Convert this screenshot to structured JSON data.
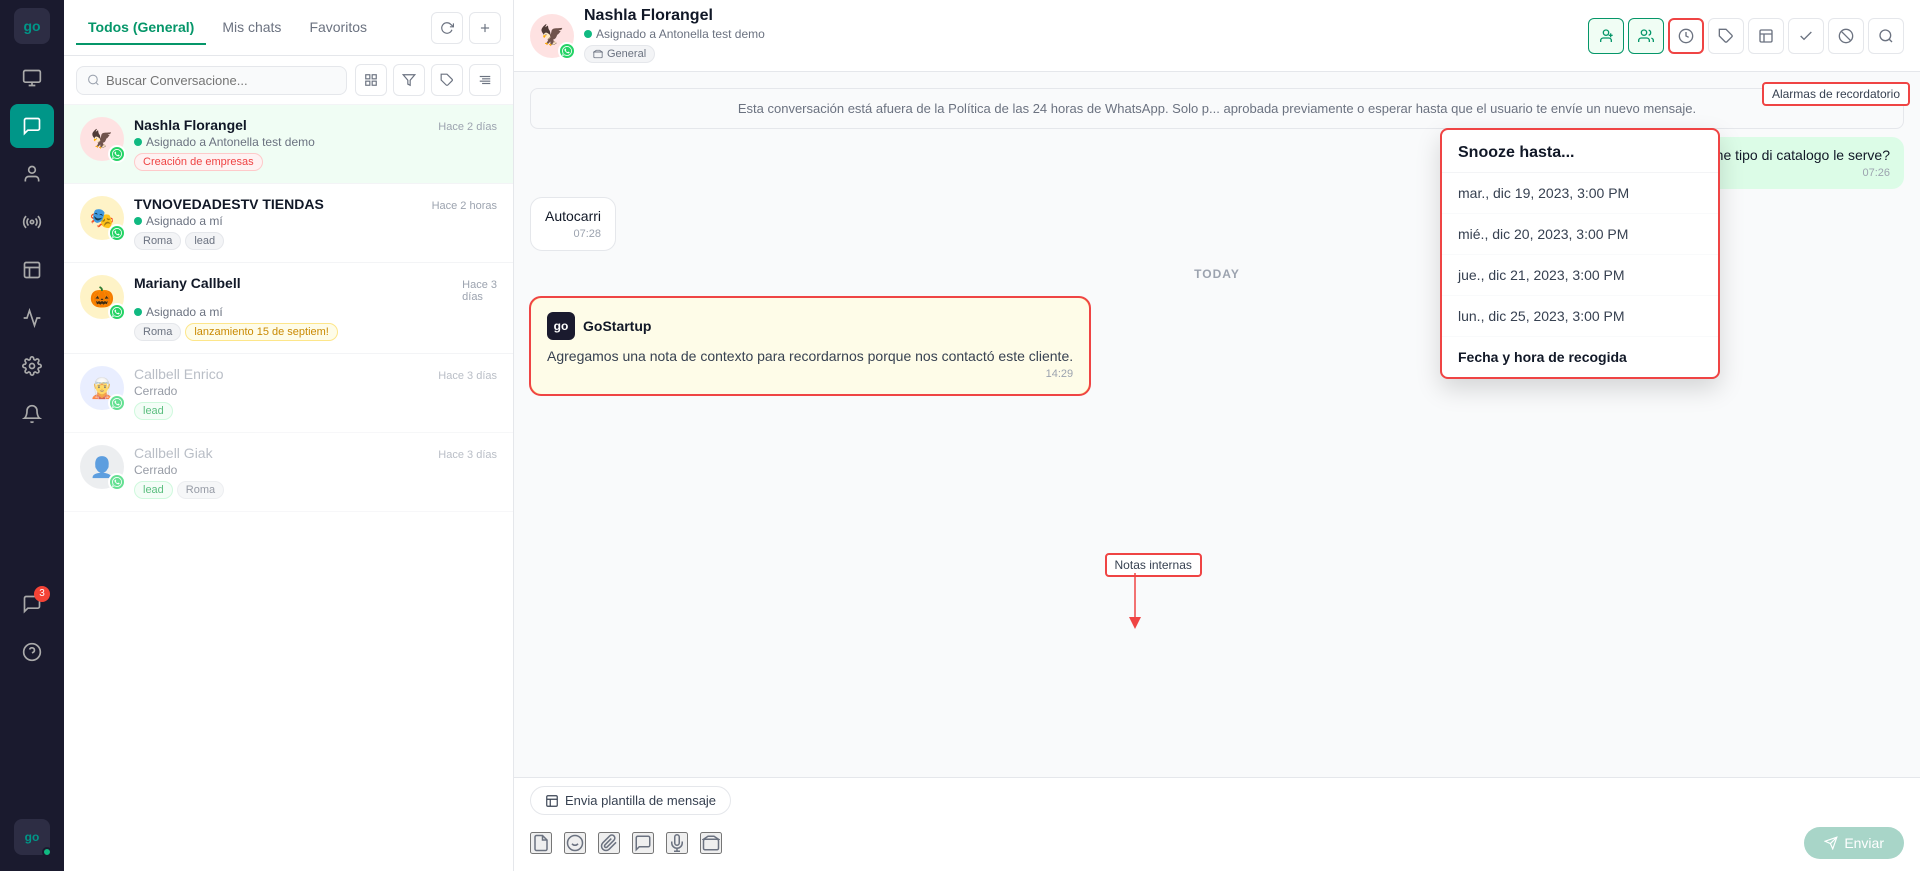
{
  "sidebar": {
    "logo": "go",
    "icons": [
      {
        "name": "home-icon",
        "symbol": "⌂",
        "active": false
      },
      {
        "name": "chat-icon",
        "symbol": "💬",
        "active": true
      },
      {
        "name": "contacts-icon",
        "symbol": "👤",
        "active": false
      },
      {
        "name": "broadcast-icon",
        "symbol": "📡",
        "active": false
      },
      {
        "name": "notes-icon",
        "symbol": "📋",
        "active": false
      },
      {
        "name": "analytics-icon",
        "symbol": "📈",
        "active": false
      },
      {
        "name": "settings-icon",
        "symbol": "⚙",
        "active": false
      },
      {
        "name": "notifications-icon",
        "symbol": "🔔",
        "active": false,
        "badge": null
      },
      {
        "name": "whatsapp-icon",
        "symbol": "💬",
        "active": false,
        "badge": "3"
      },
      {
        "name": "help-icon",
        "symbol": "?",
        "active": false
      }
    ]
  },
  "chatList": {
    "tabs": [
      {
        "label": "Todos (General)",
        "active": true
      },
      {
        "label": "Mis chats",
        "active": false
      },
      {
        "label": "Favoritos",
        "active": false
      }
    ],
    "searchPlaceholder": "Buscar Conversacione...",
    "chats": [
      {
        "id": 1,
        "name": "Nashla Florangel",
        "agent": "Asignado a Antonella test demo",
        "time": "Hace 2 días",
        "tags": [
          "Creación de empresas"
        ],
        "tagColors": [
          "red"
        ],
        "avatar": "🦅",
        "avatarBg": "#fee2e2",
        "active": true,
        "status": "online",
        "channel": "whatsapp"
      },
      {
        "id": 2,
        "name": "TVNOVEDADESTV TIENDAS",
        "agent": "Asignado a mí",
        "time": "Hace 2 horas",
        "tags": [
          "Roma",
          "lead"
        ],
        "tagColors": [
          "gray",
          "gray"
        ],
        "avatar": "🎭",
        "avatarBg": "#fef3c7",
        "active": false,
        "status": "online",
        "channel": "whatsapp"
      },
      {
        "id": 3,
        "name": "Mariany Callbell",
        "agent": "Asignado a mí",
        "time": "Hace 3 días",
        "tags": [
          "Roma",
          "lanzamiento 15 de septiem!"
        ],
        "tagColors": [
          "gray",
          "yellow"
        ],
        "avatar": "🎃",
        "avatarBg": "#fef3c7",
        "active": false,
        "status": "online",
        "channel": "whatsapp"
      },
      {
        "id": 4,
        "name": "Callbell Enrico",
        "agent": "Cerrado",
        "time": "Hace 3 días",
        "tags": [
          "lead"
        ],
        "tagColors": [
          "green"
        ],
        "avatar": "🧝",
        "avatarBg": "#e0e7ff",
        "active": false,
        "status": "offline",
        "channel": "whatsapp"
      },
      {
        "id": 5,
        "name": "Callbell Giak",
        "agent": "Cerrado",
        "time": "Hace 3 días",
        "tags": [
          "lead",
          "Roma"
        ],
        "tagColors": [
          "green",
          "gray"
        ],
        "avatar": "👤",
        "avatarBg": "#e5e7eb",
        "active": false,
        "status": "offline",
        "channel": "whatsapp"
      }
    ]
  },
  "chatHeader": {
    "contactName": "Nashla Florangel",
    "agentLabel": "Asignado a Antonella test demo",
    "inboxLabel": "General",
    "actions": [
      {
        "name": "assign-icon",
        "symbol": "👤+",
        "tooltip": "Asignar"
      },
      {
        "name": "team-icon",
        "symbol": "👥",
        "tooltip": "Equipo"
      },
      {
        "name": "snooze-icon",
        "symbol": "⏰",
        "tooltip": "Snooze",
        "highlighted": true
      },
      {
        "name": "label-icon",
        "symbol": "🏷",
        "tooltip": "Etiqueta"
      },
      {
        "name": "history-icon",
        "symbol": "📋",
        "tooltip": "Historial"
      },
      {
        "name": "resolve-icon",
        "symbol": "✓",
        "tooltip": "Resolver"
      },
      {
        "name": "block-icon",
        "symbol": "⊘",
        "tooltip": "Bloquear"
      },
      {
        "name": "search-icon",
        "symbol": "🔍",
        "tooltip": "Buscar"
      }
    ]
  },
  "messages": {
    "policyWarning": "Esta conversación está afuera de la Política de las 24 horas de WhatsApp. Solo p... aprobada previamente o esperar hasta que el usuario te envíe un nuevo mensaje.",
    "outgoingMsg": "Che tipo di catalogo le serve?",
    "outgoingTime": "07:26",
    "incomingMsg": "Autocarri",
    "incomingTime": "07:28",
    "dayDivider": "TODAY",
    "note": {
      "brandIcon": "go",
      "brandName": "GoStartup",
      "text": "Agregamos una nota de contexto para recordarnos porque nos contactó este cliente.",
      "time": "14:29"
    }
  },
  "snooze": {
    "title": "Snooze hasta...",
    "options": [
      "mar., dic 19, 2023, 3:00 PM",
      "mié., dic 20, 2023, 3:00 PM",
      "jue., dic 21, 2023, 3:00 PM",
      "lun., dic 25, 2023, 3:00 PM"
    ],
    "footer": "Fecha y hora de recogida"
  },
  "annotations": {
    "notesLabel": "Notas internas",
    "reminderLabel": "Alarmas de recordatorio"
  },
  "inputArea": {
    "templateBtn": "Envia plantilla de mensaje",
    "sendBtn": "Enviar"
  },
  "colors": {
    "teal": "#059669",
    "red": "#ef4444",
    "whatsappGreen": "#25d366"
  }
}
